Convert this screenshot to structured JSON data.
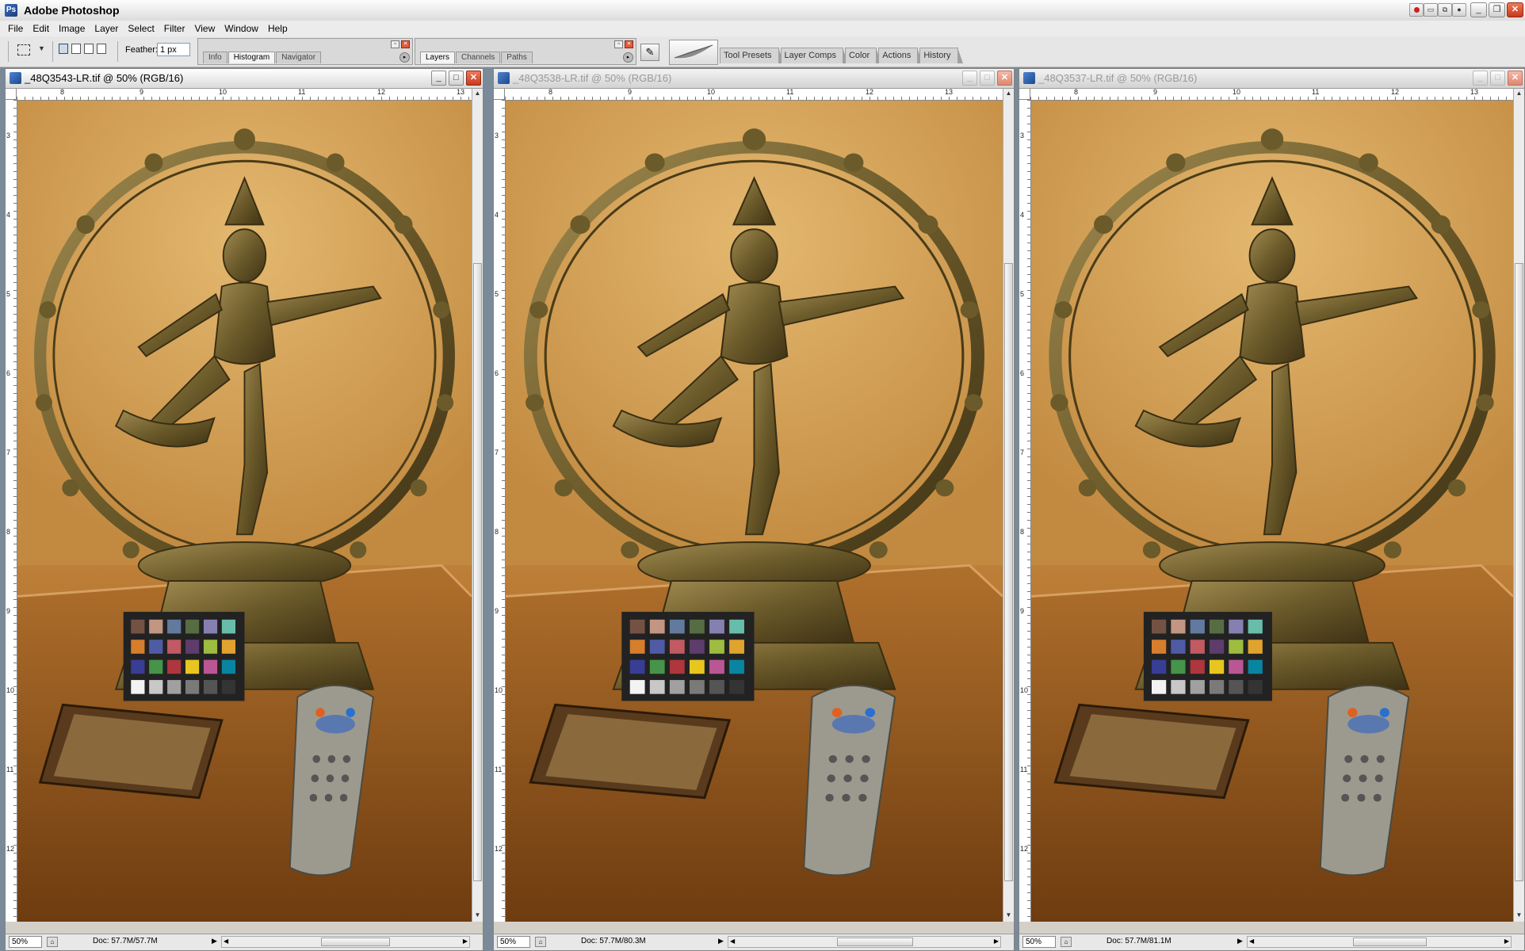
{
  "app": {
    "title": "Adobe Photoshop"
  },
  "menu": [
    "File",
    "Edit",
    "Image",
    "Layer",
    "Select",
    "Filter",
    "View",
    "Window",
    "Help"
  ],
  "options": {
    "feather_label": "Feather:",
    "feather_value": "1 px"
  },
  "palette_well_1": {
    "tabs": [
      "Info",
      "Histogram",
      "Navigator"
    ],
    "active": "Histogram"
  },
  "palette_well_2": {
    "tabs": [
      "Layers",
      "Channels",
      "Paths"
    ],
    "active": "Layers"
  },
  "dock_tabs": [
    "Tool Presets",
    "Layer Comps",
    "Color",
    "Actions",
    "History"
  ],
  "documents": [
    {
      "name": "_48Q3543-LR.tif @ 50% (RGB/16)",
      "zoom": "50%",
      "doc_size": "Doc: 57.7M/57.7M",
      "active": true,
      "ruler_top": [
        "8",
        "9",
        "10",
        "11",
        "12",
        "13"
      ],
      "ruler_left": [
        "3",
        "4",
        "5",
        "6",
        "7",
        "8",
        "9",
        "10",
        "11",
        "12"
      ]
    },
    {
      "name": "_48Q3538-LR.tif @ 50% (RGB/16)",
      "zoom": "50%",
      "doc_size": "Doc: 57.7M/80.3M",
      "active": false,
      "ruler_top": [
        "8",
        "9",
        "10",
        "11",
        "12",
        "13"
      ],
      "ruler_left": [
        "3",
        "4",
        "5",
        "6",
        "7",
        "8",
        "9",
        "10",
        "11",
        "12"
      ]
    },
    {
      "name": "_48Q3537-LR.tif @ 50% (RGB/16)",
      "zoom": "50%",
      "doc_size": "Doc: 57.7M/81.1M",
      "active": false,
      "ruler_top": [
        "8",
        "9",
        "10",
        "11",
        "12",
        "13"
      ],
      "ruler_left": [
        "3",
        "4",
        "5",
        "6",
        "7",
        "8",
        "9",
        "10",
        "11",
        "12"
      ]
    }
  ],
  "colors": {
    "wall": "#d9a95c",
    "table": "#9a5b1f",
    "bronze": "#6b5a2a",
    "close_red": "#c8381c"
  },
  "icons": {
    "app": "photoshop-icon",
    "marquee": "rectangular-marquee-icon",
    "brush": "brush-palette-icon",
    "feather": "feather-logo-icon"
  }
}
